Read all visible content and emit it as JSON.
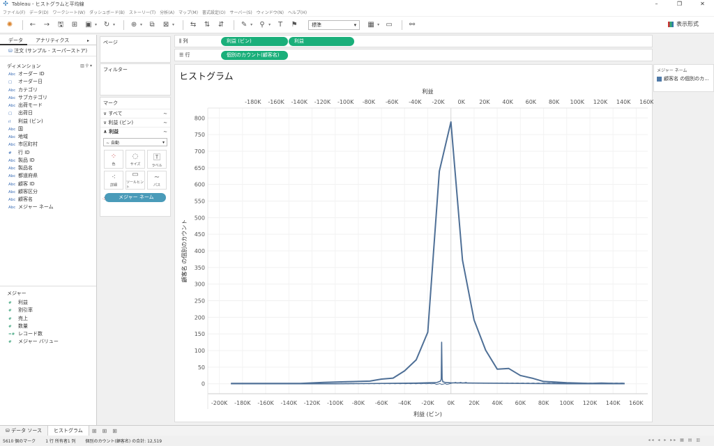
{
  "window": {
    "title": "Tableau - ヒストグラムと平均線"
  },
  "menu": [
    "ファイル(F)",
    "データ(D)",
    "ワークシート(W)",
    "ダッシュボード(B)",
    "ストーリー(T)",
    "分析(A)",
    "マップ(M)",
    "書式設定(O)",
    "サーバー(S)",
    "ウィンドウ(N)",
    "ヘルプ(H)"
  ],
  "toolbar": {
    "fit_value": "標準",
    "show_me_label": "表示形式"
  },
  "data_panel": {
    "tabs": [
      "データ",
      "アナリティクス"
    ],
    "datasource": "注文 (サンプル - スーパーストア)",
    "dimensions_header": "ディメンション",
    "dimensions": [
      {
        "icon": "Abc",
        "label": "オーダー ID"
      },
      {
        "icon": "▢",
        "label": "オーダー日"
      },
      {
        "icon": "Abc",
        "label": "カテゴリ"
      },
      {
        "icon": "Abc",
        "label": "サブカテゴリ"
      },
      {
        "icon": "Abc",
        "label": "出荷モード"
      },
      {
        "icon": "▢",
        "label": "出荷日"
      },
      {
        "icon": "ıl",
        "label": "利益 (ビン)"
      },
      {
        "icon": "Abc",
        "label": "国"
      },
      {
        "icon": "Abc",
        "label": "地域"
      },
      {
        "icon": "Abc",
        "label": "市区町村"
      },
      {
        "icon": "#",
        "label": "行 ID"
      },
      {
        "icon": "Abc",
        "label": "製品 ID"
      },
      {
        "icon": "Abc",
        "label": "製品名"
      },
      {
        "icon": "Abc",
        "label": "都道府県"
      },
      {
        "icon": "Abc",
        "label": "顧客 ID"
      },
      {
        "icon": "Abc",
        "label": "顧客区分"
      },
      {
        "icon": "Abc",
        "label": "顧客名"
      },
      {
        "icon": "Abc",
        "label": "メジャー ネーム"
      }
    ],
    "measures_header": "メジャー",
    "measures": [
      {
        "icon": "#",
        "label": "利益"
      },
      {
        "icon": "#",
        "label": "割引率"
      },
      {
        "icon": "#",
        "label": "売上"
      },
      {
        "icon": "#",
        "label": "数量"
      },
      {
        "icon": "=#",
        "label": "レコード数"
      },
      {
        "icon": "#",
        "label": "メジャー バリュー"
      }
    ]
  },
  "pages_label": "ページ",
  "filters_label": "フィルター",
  "marks": {
    "title": "マーク",
    "rows": [
      "すべて",
      "利益 (ビン)",
      "利益"
    ],
    "mark_type": "自動",
    "buttons": [
      "色",
      "サイズ",
      "ラベル",
      "詳細",
      "ツールヒント",
      "パス"
    ],
    "pill": "メジャー ネーム"
  },
  "shelves": {
    "columns_label": "列",
    "rows_label": "行",
    "columns_pills": [
      "利益 (ビン)",
      "利益"
    ],
    "rows_pills": [
      "個別のカウント(顧客名)"
    ]
  },
  "sheet_title": "ヒストグラム",
  "legend": {
    "title": "メジャー ネーム",
    "item": "顧客名 の個別のカ..."
  },
  "chart_data": {
    "type": "line",
    "title": "ヒストグラム",
    "xlabel": "利益 (ビン)",
    "top_xlabel": "利益",
    "ylabel": "顧客名 の個別のカウント",
    "x_ticks": [
      "-200K",
      "-180K",
      "-160K",
      "-140K",
      "-120K",
      "-100K",
      "-80K",
      "-60K",
      "-40K",
      "-20K",
      "0K",
      "20K",
      "40K",
      "60K",
      "80K",
      "100K",
      "120K",
      "140K",
      "160K"
    ],
    "top_ticks": [
      "-180K",
      "-160K",
      "-140K",
      "-120K",
      "-100K",
      "-80K",
      "-60K",
      "-40K",
      "-20K",
      "0K",
      "20K",
      "40K",
      "60K",
      "80K",
      "100K",
      "120K",
      "140K",
      "160K"
    ],
    "y_ticks": [
      0,
      50,
      100,
      150,
      200,
      250,
      300,
      350,
      400,
      450,
      500,
      550,
      600,
      650,
      700,
      750,
      800
    ],
    "xlim": [
      -210000,
      170000
    ],
    "ylim": [
      -30,
      830
    ],
    "series": [
      {
        "name": "顧客名 の個別のカウント",
        "x": [
          -190000,
          -170000,
          -150000,
          -130000,
          -110000,
          -90000,
          -70000,
          -60000,
          -50000,
          -40000,
          -30000,
          -20000,
          -10000,
          0,
          10000,
          20000,
          30000,
          40000,
          50000,
          60000,
          70000,
          80000,
          90000,
          100000,
          110000,
          120000,
          130000,
          140000,
          150000
        ],
        "values": [
          1,
          1,
          1,
          1,
          4,
          6,
          8,
          14,
          17,
          39,
          72,
          155,
          640,
          788,
          372,
          192,
          101,
          44,
          46,
          25,
          17,
          7,
          5,
          3,
          2,
          1,
          2,
          1,
          1
        ]
      },
      {
        "name": "利益",
        "x": [
          -190000,
          -100000,
          -60000,
          -30000,
          -12000,
          -9000,
          -8400,
          -8000,
          -7600,
          -7000,
          -5000,
          0,
          20000,
          60000,
          100000,
          150000
        ],
        "values": [
          0,
          0,
          1,
          2,
          4,
          8,
          14,
          125,
          15,
          6,
          4,
          3,
          2,
          1,
          0,
          0
        ]
      }
    ]
  },
  "tabs_bottom": {
    "datasource": "データ ソース",
    "sheet": "ヒストグラム"
  },
  "status": {
    "marks": "5610 個のマーク",
    "rows_cols": "1 行 所有者1 列",
    "sum": "個別のカウント(顧客名) の合計: 12,519"
  }
}
